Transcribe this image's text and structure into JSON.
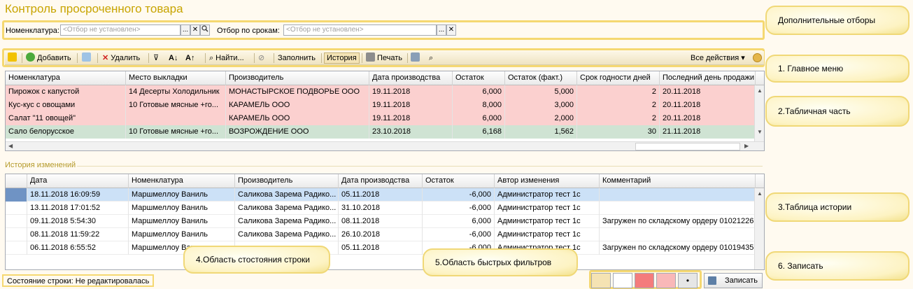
{
  "window": {
    "title": "Контроль просроченного товара"
  },
  "filters": {
    "nomenclature_label": "Номенклатура:",
    "nomenclature_placeholder": "<Отбор не установлен>",
    "dates_label": "Отбор по срокам:",
    "dates_placeholder": "<Отбор не установлен>",
    "ellipsis": "...",
    "clear": "✕"
  },
  "toolbar": {
    "add": "Добавить",
    "delete": "Удалить",
    "find": "Найти...",
    "fill": "Заполнить",
    "history": "История",
    "print": "Печать",
    "all_actions": "Все действия"
  },
  "main_table": {
    "columns": [
      "Номенклатура",
      "Место выкладки",
      "Производитель",
      "Дата производства",
      "Остаток",
      "Остаток (факт.)",
      "Срок годности дней",
      "Последний день продажи"
    ],
    "rows": [
      {
        "status": "red",
        "cells": [
          "Пирожок с капустой",
          "14 Десерты Холодильник",
          "МОНАСТЫРСКОЕ ПОДВОРЬЕ ООО",
          "19.11.2018",
          "6,000",
          "5,000",
          "2",
          "20.11.2018"
        ]
      },
      {
        "status": "red",
        "cells": [
          "Кус-кус с овощами",
          "10 Готовые мясные +го...",
          "КАРАМЕЛЬ ООО",
          "19.11.2018",
          "8,000",
          "3,000",
          "2",
          "20.11.2018"
        ]
      },
      {
        "status": "red",
        "cells": [
          "Салат \"11 овощей\"",
          "",
          "КАРАМЕЛЬ ООО",
          "19.11.2018",
          "6,000",
          "2,000",
          "2",
          "20.11.2018"
        ]
      },
      {
        "status": "green",
        "cells": [
          "Сало белорусское",
          "10 Готовые мясные +го...",
          "ВОЗРОЖДЕНИЕ ООО",
          "23.10.2018",
          "6,168",
          "1,562",
          "30",
          "21.11.2018"
        ]
      }
    ]
  },
  "history": {
    "section_title": "История изменений",
    "columns": [
      "Дата",
      "Номенклатура",
      "Производитель",
      "Дата производства",
      "Остаток",
      "Автор изменения",
      "Комментарий"
    ],
    "rows": [
      [
        "18.11.2018 16:09:59",
        "Маршмеллоу Ваниль",
        "Саликова Зарема Радико...",
        "05.11.2018",
        "-6,000",
        "Администратор тест 1с",
        ""
      ],
      [
        "13.11.2018 17:01:52",
        "Маршмеллоу Ваниль",
        "Саликова Зарема Радико...",
        "31.10.2018",
        "-6,000",
        "Администратор тест 1с",
        ""
      ],
      [
        "09.11.2018 5:54:30",
        "Маршмеллоу Ваниль",
        "Саликова Зарема Радико...",
        "08.11.2018",
        "6,000",
        "Администратор тест 1с",
        "Загружен по складскому ордеру 01021226"
      ],
      [
        "08.11.2018 11:59:22",
        "Маршмеллоу Ваниль",
        "Саликова Зарема Радико...",
        "26.10.2018",
        "-6,000",
        "Администратор тест 1с",
        ""
      ],
      [
        "06.11.2018 6:55:52",
        "Маршмеллоу Ваниль",
        "",
        "05.11.2018",
        "-6,000",
        "Администратор тест 1с",
        "Загружен по складскому ордеру 01019435"
      ]
    ]
  },
  "status_bar": {
    "text": "Состояние строки: Не редактировалась"
  },
  "quick_filters": {
    "colors": [
      "#f5e3b3",
      "#ffffff",
      "#f47c7c",
      "#f9b8b8",
      "#e6e6e6"
    ],
    "last_glyph": "•"
  },
  "save_button": {
    "label": "Записать"
  },
  "callouts": {
    "extra_filters": "Дополнительные отборы",
    "main_menu": "1. Главное меню",
    "table_part": "2.Табличная часть",
    "history_table": "3.Таблица истории",
    "row_state_area": "4.Область стостояния строки",
    "quick_filters_area": "5.Область быстрых фильтров",
    "save": "6. Записать"
  }
}
